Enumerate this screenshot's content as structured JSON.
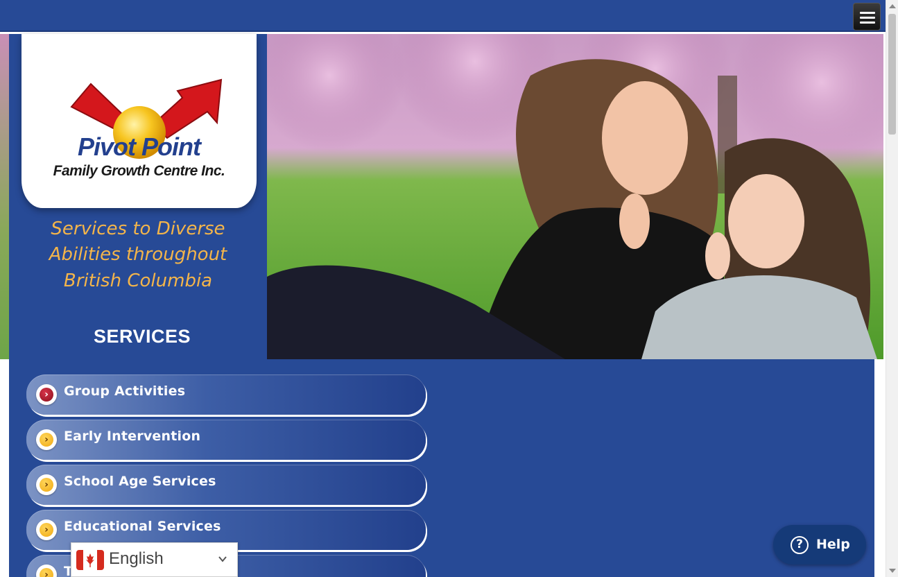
{
  "header": {
    "menu_icon": "hamburger-icon"
  },
  "logo": {
    "title": "Pivot Point",
    "subtitle": "Family Growth Centre Inc."
  },
  "tagline": {
    "line1": "Services to Diverse",
    "line2": "Abilities throughout",
    "line3": "British Columbia"
  },
  "services": {
    "heading": "SERVICES",
    "items": [
      {
        "label": "Group Activities",
        "icon": "arrow-right-icon"
      },
      {
        "label": "Early Intervention",
        "icon": "arrow-right-icon"
      },
      {
        "label": "School Age Services",
        "icon": "arrow-right-icon"
      },
      {
        "label": "Educational Services",
        "icon": "arrow-right-icon"
      },
      {
        "label": "T",
        "icon": "arrow-right-icon"
      }
    ]
  },
  "language": {
    "selected": "English",
    "flag": "canada-flag-icon"
  },
  "help": {
    "label": "Help",
    "icon": "question-icon"
  },
  "colors": {
    "brand_blue": "#274a96",
    "accent_gold": "#f4b54a",
    "help_blue": "#153a78"
  }
}
